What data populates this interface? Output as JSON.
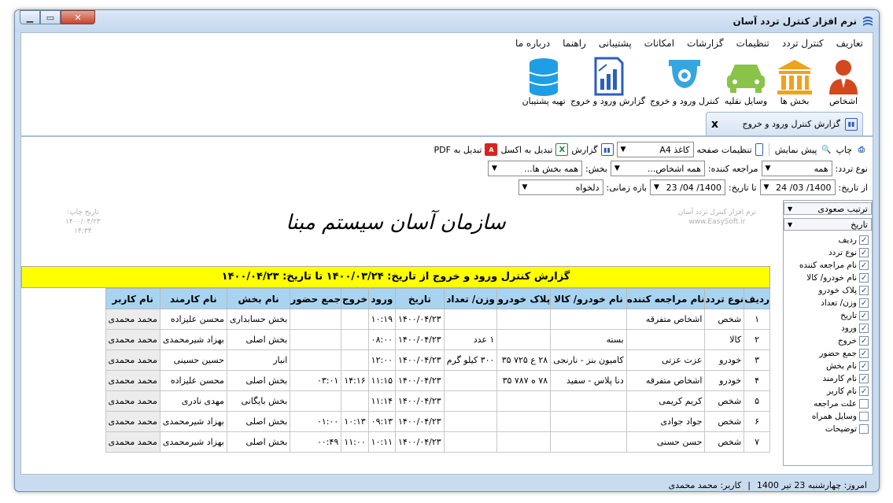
{
  "window": {
    "title": "نرم افزار کنترل تردد آسان"
  },
  "menu": [
    "تعاریف",
    "کنترل تردد",
    "تنظیمات",
    "گزارشات",
    "امکانات",
    "پشتیبانی",
    "راهنما",
    "درباره ما"
  ],
  "tools": [
    {
      "label": "اشخاص",
      "icon": "person-icon",
      "color": "#d2491f"
    },
    {
      "label": "بخش ها",
      "icon": "building-icon",
      "color": "#f0a21c"
    },
    {
      "label": "وسایل نقلیه",
      "icon": "car-icon",
      "color": "#8ac34a"
    },
    {
      "label": "کنترل ورود و خروج",
      "icon": "camera-icon",
      "color": "#37a6e0"
    },
    {
      "label": "گزارش ورود و خروج",
      "icon": "report-icon",
      "color": "#2a5fbf"
    },
    {
      "label": "تهیه پشتیبان",
      "icon": "database-icon",
      "color": "#1f9ee6"
    }
  ],
  "tab": {
    "label": "گزارش کنترل ورود و خروج",
    "close": "x"
  },
  "toolbar": {
    "print": "چاپ",
    "preview": "پیش نمایش",
    "page_settings": "تنظیمات صفحه",
    "paper": "کاغذ A4",
    "report": "گزارش",
    "to_excel": "تبدیل به اکسل",
    "to_pdf": "تبدیل به PDF"
  },
  "filters": {
    "type_label": "نوع تردد:",
    "type_value": "همه",
    "visitor_label": "مراجعه کننده:",
    "visitor_value": "همه اشخاص...",
    "section_label": "بخش:",
    "section_value": "همه بخش ها...",
    "from_label": "از تاریخ:",
    "from_value": "1400/ 03/ 24",
    "to_label": "تا تاریخ:",
    "to_value": "1400/ 04/ 23",
    "range_label": "بازه زمانی:",
    "range_value": "دلخواه"
  },
  "report": {
    "corp_name": "سازمان آسان سیستم مبنا",
    "faint_right": "نرم افزار کنترل تردد آسان\nwww.EasySoft.ir",
    "faint_left": "تاریخ چاپ:\n۱۴۰۰/۰۴/۲۳\n۱۴:۳۴",
    "heading": "گزارش کنترل ورود و خروج از تاریخ: ۱۴۰۰/۰۳/۲۴ تا تاریخ: ۱۴۰۰/۰۴/۲۳",
    "columns": [
      "ردیف",
      "نوع تردد",
      "نام مراجعه کننده",
      "نام خودرو/ کالا",
      "پلاک خودرو",
      "وزن/ تعداد",
      "تاریخ",
      "ورود",
      "خروج",
      "جمع حضور",
      "نام بخش",
      "نام کارمند",
      "نام کاربر"
    ],
    "rows": [
      [
        "۱",
        "شخص",
        "اشخاص متفرقه",
        "",
        "",
        "",
        "۱۴۰۰/۰۴/۲۳",
        "۱۰:۱۹",
        "",
        "",
        "بخش حسابداری",
        "محسن علیزاده",
        "محمد محمدی"
      ],
      [
        "۲",
        "کالا",
        "",
        "بسته",
        "",
        "۱ عدد",
        "۱۴۰۰/۰۴/۲۳",
        "۰۸:۰۰",
        "",
        "",
        "بخش اصلی",
        "بهزاد شیرمحمدی",
        "محمد محمدی"
      ],
      [
        "۳",
        "خودرو",
        "عزت عزتی",
        "کامیون بنز - نارنجی",
        "۲۸ ع ۷۲۵ ۳۵",
        "۳۰۰ کیلو گرم",
        "۱۴۰۰/۰۴/۲۳",
        "۱۲:۰۰",
        "",
        "",
        "انبار",
        "حسین حسینی",
        "محمد محمدی"
      ],
      [
        "۴",
        "خودرو",
        "اشخاص متفرقه",
        "دنا پلاس - سفید",
        "۷۸ ه ۷۸۷ ۳۵",
        "",
        "۱۴۰۰/۰۴/۲۳",
        "۱۱:۱۵",
        "۱۴:۱۶",
        "۰۳:۰۱",
        "بخش اصلی",
        "محسن علیزاده",
        "محمد محمدی"
      ],
      [
        "۵",
        "شخص",
        "کریم کریمی",
        "",
        "",
        "",
        "۱۴۰۰/۰۴/۲۳",
        "۱۱:۱۴",
        "",
        "",
        "بخش بایگانی",
        "مهدی نادری",
        "محمد محمدی"
      ],
      [
        "۶",
        "شخص",
        "جواد جوادی",
        "",
        "",
        "",
        "۱۴۰۰/۰۴/۲۳",
        "۰۹:۱۳",
        "۱۰:۱۳",
        "۰۱:۰۰",
        "بخش اصلی",
        "بهزاد شیرمحمدی",
        "محمد محمدی"
      ],
      [
        "۷",
        "شخص",
        "حسن حسنی",
        "",
        "",
        "",
        "۱۴۰۰/۰۴/۲۳",
        "۱۰:۱۱",
        "۱۱:۰۰",
        "۰۰:۴۹",
        "بخش اصلی",
        "بهزاد شیرمحمدی",
        "محمد محمدی"
      ]
    ]
  },
  "side": {
    "sort_label": "ترتیب صعودی",
    "sort_field": "تاریخ",
    "fields": [
      {
        "label": "ردیف",
        "checked": true
      },
      {
        "label": "نوع تردد",
        "checked": true
      },
      {
        "label": "نام مراجعه کننده",
        "checked": true
      },
      {
        "label": "نام خودرو/ کالا",
        "checked": true
      },
      {
        "label": "پلاک خودرو",
        "checked": true
      },
      {
        "label": "وزن/ تعداد",
        "checked": true
      },
      {
        "label": "تاریخ",
        "checked": true
      },
      {
        "label": "ورود",
        "checked": true
      },
      {
        "label": "خروج",
        "checked": true
      },
      {
        "label": "جمع حضور",
        "checked": true
      },
      {
        "label": "نام بخش",
        "checked": true
      },
      {
        "label": "نام کارمند",
        "checked": true
      },
      {
        "label": "نام کاربر",
        "checked": true
      },
      {
        "label": "علت مراجعه",
        "checked": false
      },
      {
        "label": "وسایل همراه",
        "checked": false
      },
      {
        "label": "توضیحات",
        "checked": false
      }
    ]
  },
  "status": {
    "today": "امروز: چهارشنبه 23 تیر 1400",
    "sep": "|",
    "user": "کاربر: محمد محمدی"
  }
}
